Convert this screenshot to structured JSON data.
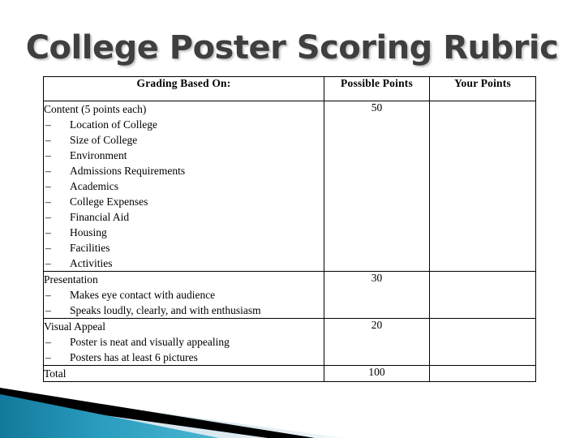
{
  "slide": {
    "title": "College Poster Scoring Rubric",
    "title_color": "#3f3f3f",
    "background_color": "#ffffff"
  },
  "table": {
    "headers": {
      "criteria": "Grading Based On:",
      "possible": "Possible Points",
      "yours": "Your Points"
    },
    "rows": [
      {
        "section": "Content (5 points each)",
        "bullets": [
          "Location of College",
          "Size of College",
          "Environment",
          "Admissions Requirements",
          "Academics",
          "College Expenses",
          "Financial Aid",
          "Housing",
          "Facilities",
          "Activities"
        ],
        "possible_points": "50",
        "your_points": ""
      },
      {
        "section": "Presentation",
        "bullets": [
          "Makes eye contact with audience",
          "Speaks loudly, clearly, and with enthusiasm"
        ],
        "possible_points": "30",
        "your_points": ""
      },
      {
        "section": "Visual Appeal",
        "bullets": [
          "Poster is neat and visually appealing",
          "Posters has at least 6 pictures"
        ],
        "possible_points": "20",
        "your_points": ""
      },
      {
        "section": "Total",
        "bullets": [],
        "possible_points": "100",
        "your_points": ""
      }
    ],
    "bullet_marker": "–",
    "border_color": "#000000"
  },
  "decoration": {
    "name": "bottom-left-angled-banner",
    "teal_dark": "#12799c",
    "teal_light": "#43b0cc",
    "stripe_black": "#000000",
    "band_light": "#d7e6ee"
  }
}
